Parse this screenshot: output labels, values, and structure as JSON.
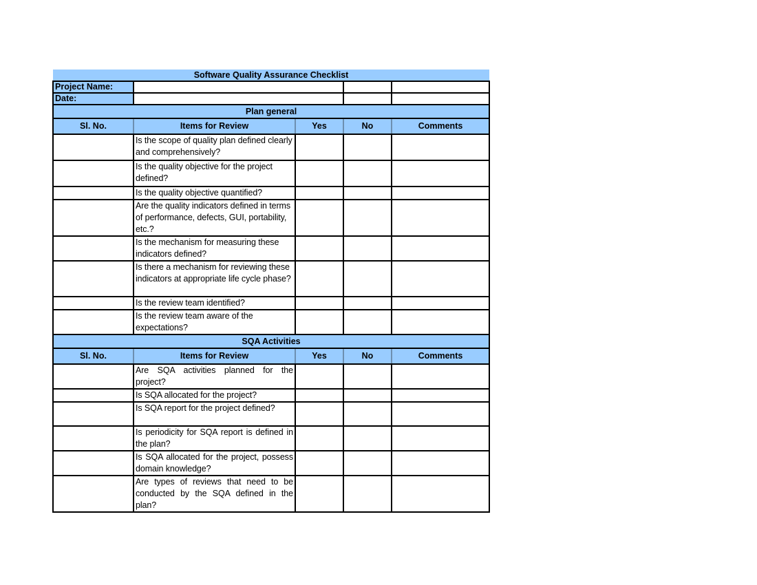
{
  "title": "Software Quality Assurance Checklist",
  "meta": {
    "project_name_label": "Project Name:",
    "project_name_value": "",
    "date_label": "Date:",
    "date_value": ""
  },
  "columns": {
    "sl_no": "Sl. No.",
    "items": "Items for Review",
    "yes": "Yes",
    "no": "No",
    "comments": "Comments"
  },
  "sections": [
    {
      "title": "Plan general",
      "items": [
        "Is the scope of quality plan defined clearly and comprehensively?",
        "Is the quality objective for the project defined?",
        "Is the quality objective quantified?",
        "Are the quality indicators defined in terms of performance, defects, GUI, portability, etc.?",
        "Is the mechanism for measuring these indicators defined?",
        "Is there a mechanism for reviewing these indicators at appropriate life cycle phase?",
        "Is the review team identified?",
        "Is the review team aware of the expectations?"
      ]
    },
    {
      "title": "SQA Activities",
      "items": [
        "Are SQA activities planned for the project?",
        "Is SQA allocated for the project?",
        "Is SQA report for the project defined?",
        "Is periodicity for SQA report is defined in the plan?",
        "Is SQA allocated for the project, possess domain knowledge?",
        "Are types of reviews that need to be conducted by the SQA defined in the plan?"
      ]
    }
  ]
}
